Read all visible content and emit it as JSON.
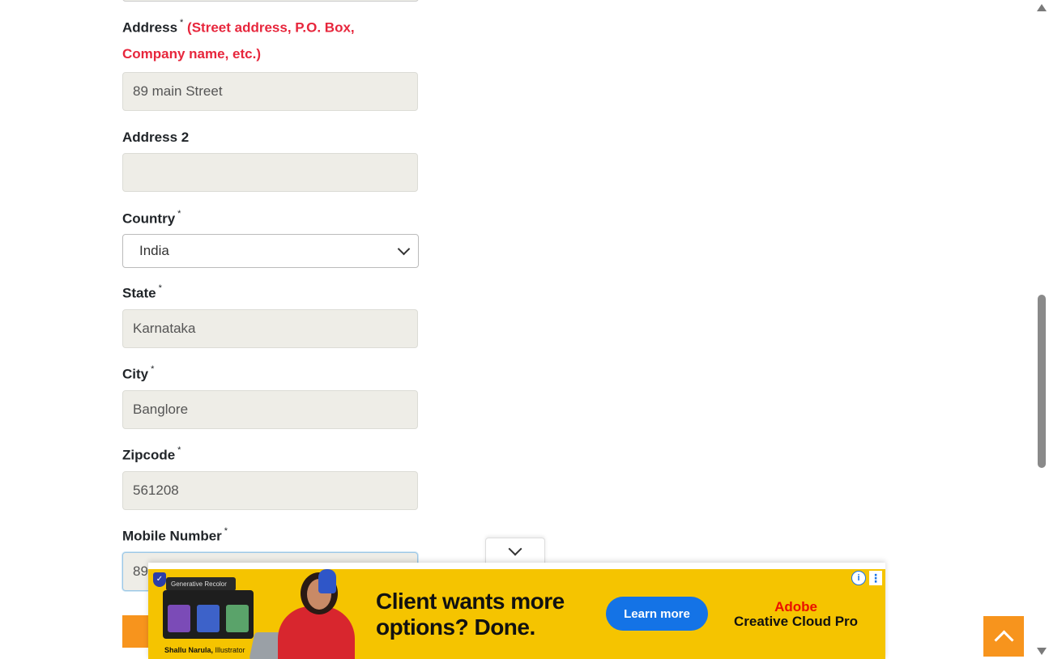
{
  "form": {
    "address": {
      "label": "Address",
      "required": "*",
      "hint": "(Street address, P.O. Box,",
      "hint2": "Company name, etc.)",
      "value": "89 main Street"
    },
    "address2": {
      "label": "Address 2",
      "value": ""
    },
    "country": {
      "label": "Country",
      "required": "*",
      "selected": "India"
    },
    "state": {
      "label": "State",
      "required": "*",
      "value": "Karnataka"
    },
    "city": {
      "label": "City",
      "required": "*",
      "value": "Banglore"
    },
    "zipcode": {
      "label": "Zipcode",
      "required": "*",
      "value": "561208"
    },
    "mobile": {
      "label": "Mobile Number",
      "required": "*",
      "value": "89"
    }
  },
  "ad": {
    "headline_line1": "Client wants more",
    "headline_line2": "options? Done.",
    "cta": "Learn more",
    "brand_line1": "Adobe",
    "brand_line2": "Creative Cloud Pro",
    "mock_label": "Generative Recolor",
    "caption_name": "Shallu Narula,",
    "caption_role": " Illustrator",
    "info_glyph": "i",
    "more_glyph": "⋮"
  },
  "colors": {
    "accent_orange": "#f7941d",
    "hint_red": "#e7263c",
    "ad_yellow": "#f5c400",
    "ad_button_blue": "#1473e6"
  }
}
